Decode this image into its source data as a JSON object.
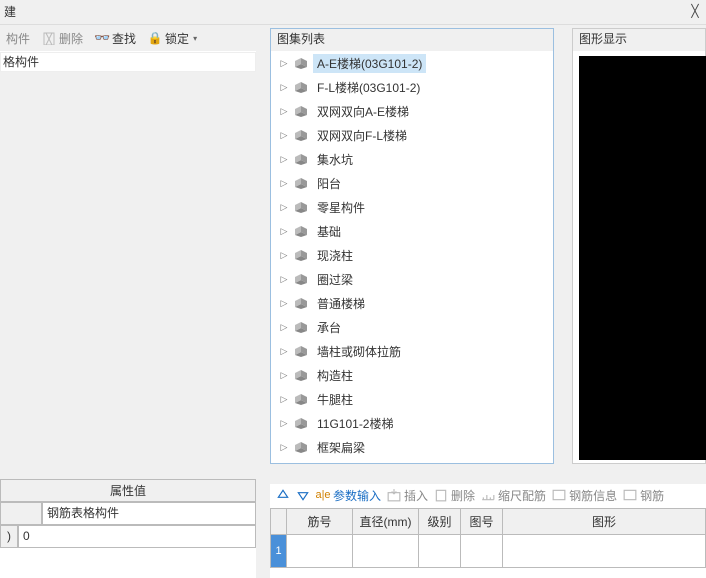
{
  "topbar": {
    "title_fragment": "建"
  },
  "toolbar": {
    "component_label": "构件",
    "delete_label": "删除",
    "find_label": "查找",
    "lock_label": "锁定"
  },
  "left_row_label": "格构件",
  "tree_panel": {
    "title": "图集列表",
    "items": [
      {
        "label": "A-E楼梯(03G101-2)",
        "selected": true
      },
      {
        "label": "F-L楼梯(03G101-2)"
      },
      {
        "label": "双网双向A-E楼梯"
      },
      {
        "label": "双网双向F-L楼梯"
      },
      {
        "label": "集水坑"
      },
      {
        "label": "阳台"
      },
      {
        "label": "零星构件"
      },
      {
        "label": "基础"
      },
      {
        "label": "现浇柱"
      },
      {
        "label": "圈过梁"
      },
      {
        "label": "普通楼梯"
      },
      {
        "label": "承台"
      },
      {
        "label": "墙柱或砌体拉筋"
      },
      {
        "label": "构造柱"
      },
      {
        "label": "牛腿柱"
      },
      {
        "label": "11G101-2楼梯"
      },
      {
        "label": "框架扁梁"
      }
    ]
  },
  "graphic_panel": {
    "title": "图形显示"
  },
  "prop_table": {
    "header": "属性值",
    "rows": [
      {
        "a": "",
        "b": "钢筋表格构件"
      },
      {
        "narrow": ")",
        "b": "0"
      }
    ]
  },
  "bottom_right": {
    "param_input": "参数输入",
    "insert": "插入",
    "delete": "删除",
    "scale": "缩尺配筋",
    "info": "钢筋信息",
    "steel": "钢筋",
    "columns": {
      "c1": "筋号",
      "c2": "直径(mm)",
      "c3": "级别",
      "c4": "图号",
      "c5": "图形"
    },
    "rownum": "1"
  }
}
